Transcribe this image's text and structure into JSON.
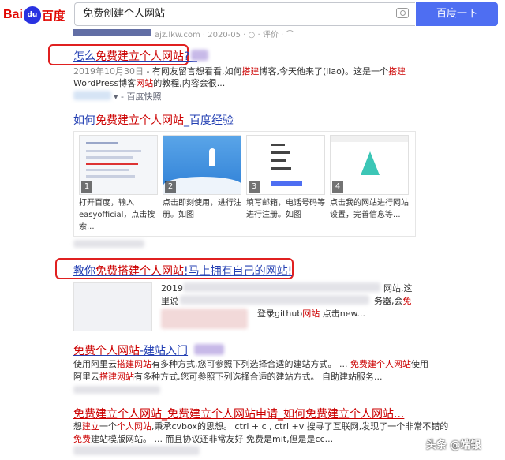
{
  "header": {
    "logo_bai": "Bai",
    "logo_paw": "du",
    "logo_du": "百度",
    "query": "免费创建个人网站",
    "search_button": "百度一下",
    "camera_icon": "camera-icon"
  },
  "prev": {
    "snippet": "ajz.lkw.com · 2020-05 · ○ · 评价 · ⌒"
  },
  "results": [
    {
      "title_a": "怎么",
      "title_em": "免费建立个人网站",
      "title_b": "? -",
      "date": "2019年10月30日",
      "snippet_1a": " - 有网友留言想看看,如何",
      "snippet_1em": "搭建",
      "snippet_1b": "博客,今天他来了(liao)。这是一个",
      "snippet_1em2": "搭建",
      "snippet_2a": "WordPress博客",
      "snippet_2em": "网站",
      "snippet_2b": "的教程,内容会很...",
      "cache": "- 百度快照"
    },
    {
      "title_a": "如何",
      "title_em": "免费建立个人网站",
      "title_b": "_百度经验"
    },
    {
      "title_a": "教你",
      "title_em": "免费搭建个人网站",
      "title_b": "!马上拥有自己的网站!",
      "snippet_1a": "2019",
      "snippet_1b": "网站,这",
      "snippet_2a": "里说",
      "snippet_2b": "务器,会",
      "snippet_2em": "免",
      "snippet_3": "登录github",
      "snippet_3em": "网站",
      "snippet_3b": " 点击new..."
    },
    {
      "title_a": "",
      "title_em": "免费个人网站",
      "title_b": "-建站入门",
      "snippet_1a": "使用阿里云",
      "snippet_1em": "搭建网站",
      "snippet_1b": "有多种方式,您可参照下列选择合适的建站方式。 ... ",
      "snippet_1em2": "免费建个人网站",
      "snippet_1c": "使用",
      "snippet_2a": "阿里云",
      "snippet_2em": "搭建网站",
      "snippet_2b": "有多种方式,您可参照下列选择合适的建站方式。 自助建站服务..."
    },
    {
      "title": "免费建立个人网站_免费建立个人网站申请_如何免费建立个人网站...",
      "snippet_1a": "想",
      "snippet_1em": "建立",
      "snippet_1b": "一个",
      "snippet_1em2": "个人网站",
      "snippet_1c": ",秉承cvbox的思想。 ctrl + c , ctrl +v 搜寻了互联网,发现了一个非常不错的",
      "snippet_2em": "免费",
      "snippet_2a": "建站",
      "snippet_2b": "模版网站。 ... 而且协议还非常友好 免费是mit,但是是cc..."
    }
  ],
  "cards": [
    {
      "num": "1",
      "text": "打开百度，输入easyofficial，点击搜索..."
    },
    {
      "num": "2",
      "text": "点击即刻使用，进行注册。如图"
    },
    {
      "num": "3",
      "text": "填写邮箱，电话号码等进行注册。如图"
    },
    {
      "num": "4",
      "text": "点击我的网站进行网站设置，完善信息等..."
    }
  ],
  "watermark": "头条 @端银",
  "colors": {
    "link": "#2440b3",
    "em": "#c00",
    "button": "#4e6ef2",
    "highlight_box": "#e02020"
  }
}
